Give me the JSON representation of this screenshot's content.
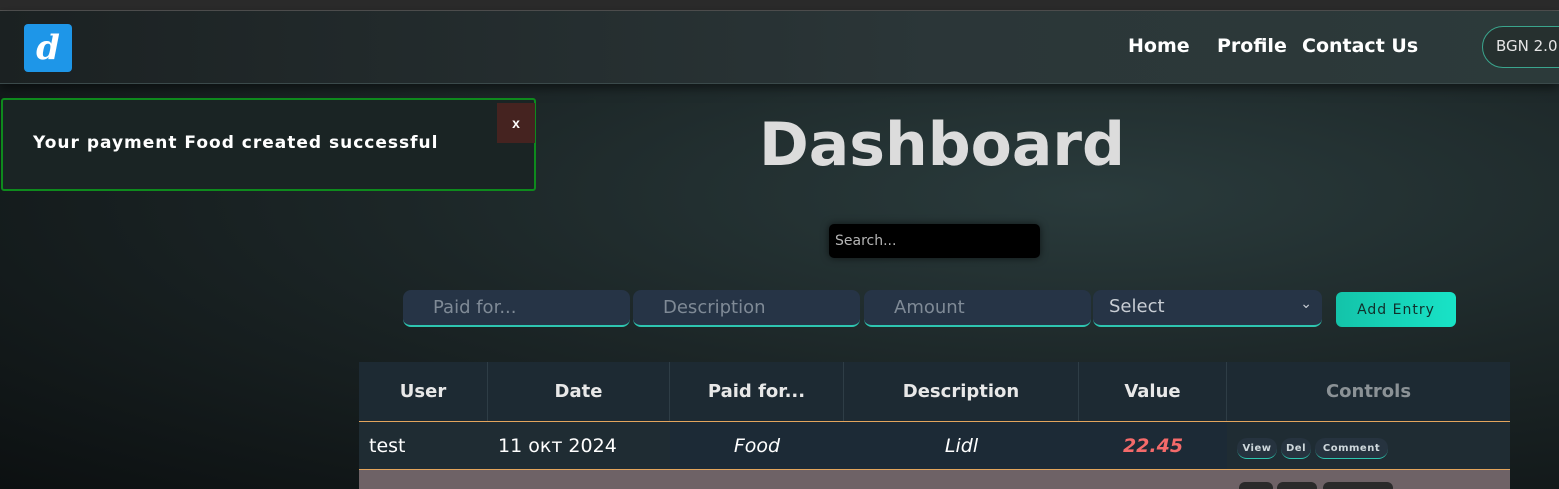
{
  "brand": {
    "logo_letter": "d"
  },
  "nav": {
    "links": [
      "Home",
      "Profile",
      "Contact Us"
    ],
    "currency": "BGN 2.0"
  },
  "toast": {
    "message": "Your payment Food created successful",
    "close_label": "x"
  },
  "page": {
    "title": "Dashboard"
  },
  "search": {
    "placeholder": "Search..."
  },
  "form": {
    "paid_for_placeholder": "Paid for...",
    "description_placeholder": "Description",
    "amount_placeholder": "Amount",
    "select_value": "Select",
    "add_button": "Add Entry"
  },
  "table": {
    "headers": [
      "User",
      "Date",
      "Paid for...",
      "Description",
      "Value",
      "Controls"
    ],
    "rows": [
      {
        "user": "test",
        "date": "11 окт 2024",
        "paid_for": "Food",
        "description": "Lidl",
        "value": "22.45",
        "actions": [
          "View",
          "Del",
          "Comment"
        ]
      }
    ]
  },
  "colors": {
    "accent": "#2ec5b0",
    "value_text": "#f46a6a",
    "toast_border": "#0e8a1d",
    "logo_bg": "#1e96e8"
  }
}
